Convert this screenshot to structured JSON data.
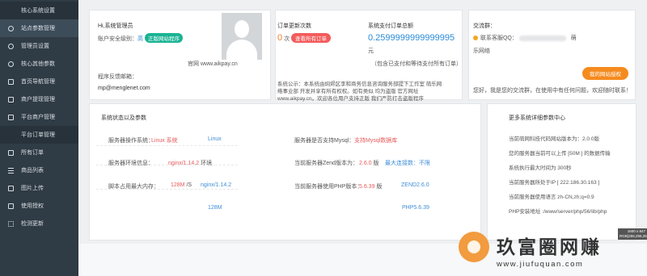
{
  "sidebar": {
    "items": [
      {
        "label": "核心系统设置",
        "icon": "none",
        "sub": true
      },
      {
        "label": "站点参数管理",
        "icon": "circle-icon",
        "sub": false,
        "active": true
      },
      {
        "label": "管理员设置",
        "icon": "circle-icon",
        "sub": false
      },
      {
        "label": "核心其他参数",
        "icon": "circle-icon",
        "sub": false
      },
      {
        "label": "首页导航管理",
        "icon": "square-icon",
        "sub": false
      },
      {
        "label": "商户提现管理",
        "icon": "square-icon",
        "sub": false
      },
      {
        "label": "平台商户管理",
        "icon": "square-icon",
        "sub": false
      },
      {
        "label": "平台订单管理",
        "icon": "none",
        "sub": true
      },
      {
        "label": "所有订单",
        "icon": "square-icon",
        "sub": false
      },
      {
        "label": "商品列表",
        "icon": "list-icon",
        "sub": false
      },
      {
        "label": "图片上传",
        "icon": "square-icon",
        "sub": false
      },
      {
        "label": "使用授权",
        "icon": "square-icon",
        "sub": false
      },
      {
        "label": "检测更新",
        "icon": "dots-icon",
        "sub": false
      }
    ]
  },
  "admin": {
    "greeting": "Hi,系统管理员",
    "security_label": "账户安全级别：",
    "security_level": "高",
    "version_badge": "正版网站程序",
    "website_label": "官网 www.aikpay.cn",
    "feedback_label": "程序反馈邮箱：",
    "feedback_email": "mp@menglenet.com"
  },
  "orders": {
    "today_label": "订单更新次数",
    "today_value": "0",
    "today_unit": "次",
    "view_button": "查看所有订单",
    "total_label": "系统支付订单总额",
    "total_value": "0.2599999999999995",
    "total_unit": "元",
    "total_note": "（包含已支付和等待支付所有订单）",
    "announcement_line1": "系统公示：本系统由焖烬区李和商务信息咨询服务部提下工作室 萌乐网",
    "announcement_line2": "络事业部 开发并享有所有权权。如有类似 均为盗版 官方网址",
    "announcement_line3": "www.aikpay.cn。欢迎各位用户支持正版 我们严防打击盗版程序"
  },
  "chat": {
    "title": "交流群：",
    "qq_label": "联系客服QQ：",
    "qq_brand": "萌",
    "network": "乐网络",
    "auth_button": "我的网站授权",
    "welcome": "您好，我是您的交流群，在使用中有任何问题，欢迎随时联系！"
  },
  "status": {
    "title": "系统状态以及参数",
    "rows": [
      {
        "left_label": "服务器操作系统：",
        "left_value": "Linux 系统",
        "left_extra": "Linux",
        "right_label": "服务器是否支持Mysql：",
        "right_value": "支持Mysql数据库",
        "right_extra": ""
      },
      {
        "left_label": "服务器环境信息：",
        "left_value": "nginx/1.14.2",
        "left_unit": "环境",
        "left_extra": "",
        "right_label": "当前服务器Zend版本为：",
        "right_value": "2.6.0",
        "right_unit": "版",
        "right_extra": "最大连接数：不限"
      },
      {
        "left_label": "脚本占用最大内存：",
        "left_value": "128M",
        "left_unit": "/S",
        "left_extra": "nginx/1.14.2",
        "right_label": "当前服务器使用PHP版本：",
        "right_value": "5.6.39",
        "right_unit": "版",
        "right_extra": "ZEND2.6.0"
      },
      {
        "left_label": "",
        "left_value": "",
        "left_unit": "",
        "left_extra": "128M",
        "right_label": "",
        "right_value": "",
        "right_unit": "",
        "right_extra": "PHP5.6.39"
      }
    ]
  },
  "details": {
    "title": "更多系统详细参数中心",
    "lines": [
      "当前萌网科技代码网站版本为：2.0.0版",
      "您的服务器当前可以上传 [50M ] 的数据传输",
      "系统执行最大时间为 300秒",
      "当前服务器所处于IP [ 222.186.30.163 ]",
      "当前服务器使用语言 zh-CN,zh;q=0.9",
      "PHP安装地址 :/www/server/php/56/lib/php"
    ]
  },
  "watermark": {
    "title": "玖富圈网赚",
    "url": "www.jiufuquan.com",
    "tag": "1600 x 847 RGB(255,255,255)"
  },
  "colors": {
    "sidebar_bg": "#2f3b45",
    "accent_green": "#1ab394",
    "accent_red": "#f35b5b",
    "accent_orange": "#f58b1f",
    "accent_blue": "#2a8bd6"
  }
}
